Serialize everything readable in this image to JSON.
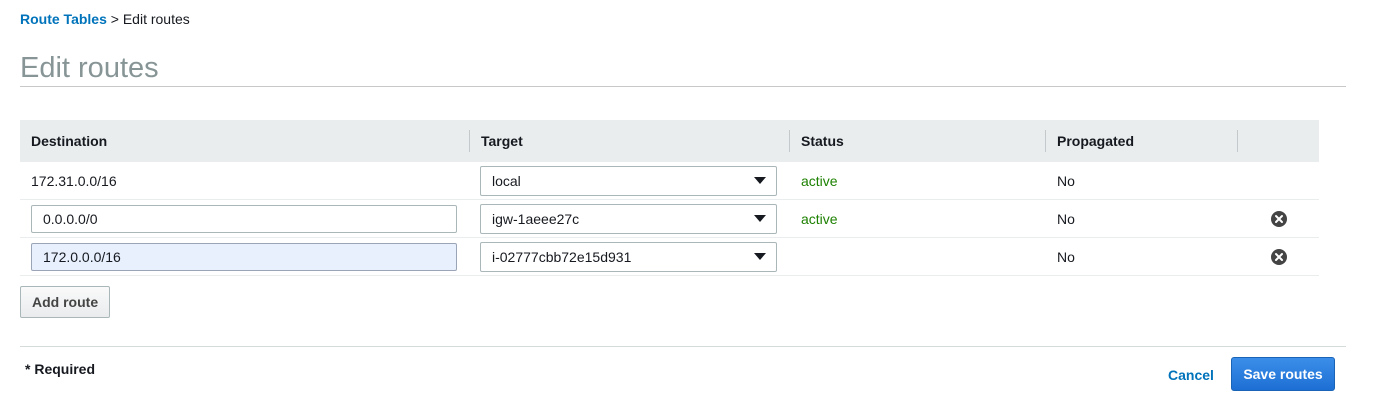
{
  "breadcrumb": {
    "parent": "Route Tables",
    "separator": " > ",
    "current": "Edit routes"
  },
  "page": {
    "title": "Edit routes"
  },
  "table": {
    "headers": [
      "Destination",
      "Target",
      "Status",
      "Propagated",
      ""
    ],
    "rows": [
      {
        "destination": "172.31.0.0/16",
        "target": "local",
        "status": "active",
        "propagated": "No"
      },
      {
        "destination": "0.0.0.0/0",
        "target": "igw-1aeee27c",
        "status": "active",
        "propagated": "No"
      },
      {
        "destination": "172.0.0.0/16",
        "target": "i-02777cbb72e15d931",
        "status": "",
        "propagated": "No"
      }
    ]
  },
  "icons": {
    "remove": "remove-circle-icon",
    "dropdown": "caret-down-icon"
  },
  "buttons": {
    "add_route": "Add route",
    "cancel": "Cancel",
    "save": "Save routes"
  },
  "footer": {
    "required": "* Required"
  },
  "colors": {
    "link": "#0073bb",
    "active": "#1d8102",
    "primary": "#1d6fd4",
    "header_bg": "#eaeded"
  }
}
